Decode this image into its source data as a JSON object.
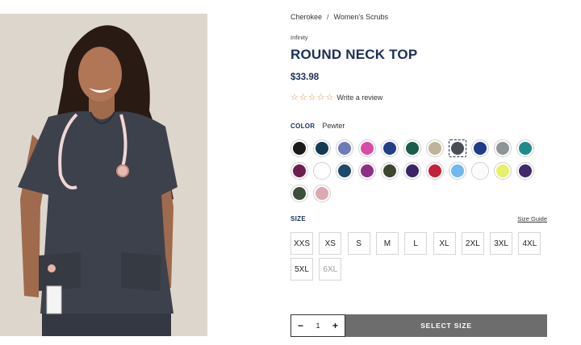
{
  "breadcrumb": {
    "brand": "Cherokee",
    "separator": "/",
    "category": "Women's Scrubs"
  },
  "product": {
    "collection": "Infinity",
    "title": "ROUND NECK TOP",
    "price": "$33.98",
    "rating": {
      "stars_filled": 0,
      "stars_total": 5,
      "review_link": "Write a review"
    }
  },
  "color": {
    "label": "COLOR",
    "selected_name": "Pewter",
    "swatches": [
      "#1a1a1a",
      "#143a52",
      "#6e7bb8",
      "#d94ca6",
      "#233f86",
      "#1c5c4a",
      "#bfb39a",
      "#4a4e55",
      "#1f3b8a",
      "#8e9598",
      "#1f8a8a",
      "#6b1f4f",
      "#ffffff",
      "#1c4a6a",
      "#8e2f86",
      "#3c4630",
      "#3a2466",
      "#c2223a",
      "#6fb8f0",
      "#fbfbfb",
      "#e8f06a",
      "#3f2a6a",
      "#3d4f3a",
      "#dba9b3"
    ],
    "selected_index": 7
  },
  "size": {
    "label": "SIZE",
    "guide_label": "Size Guide",
    "options": [
      {
        "label": "XXS",
        "available": true
      },
      {
        "label": "XS",
        "available": true
      },
      {
        "label": "S",
        "available": true
      },
      {
        "label": "M",
        "available": true
      },
      {
        "label": "L",
        "available": true
      },
      {
        "label": "XL",
        "available": true
      },
      {
        "label": "2XL",
        "available": true
      },
      {
        "label": "3XL",
        "available": true
      },
      {
        "label": "4XL",
        "available": true
      },
      {
        "label": "5XL",
        "available": true
      },
      {
        "label": "6XL",
        "available": false
      }
    ]
  },
  "cart": {
    "qty_minus": "−",
    "qty_value": "1",
    "qty_plus": "+",
    "button_label": "SELECT SIZE"
  },
  "colors": {
    "navy": "#1a2f5a",
    "star": "#e08a3c",
    "cta_bg": "#6d6d6d",
    "scrub": "#3d414b"
  }
}
